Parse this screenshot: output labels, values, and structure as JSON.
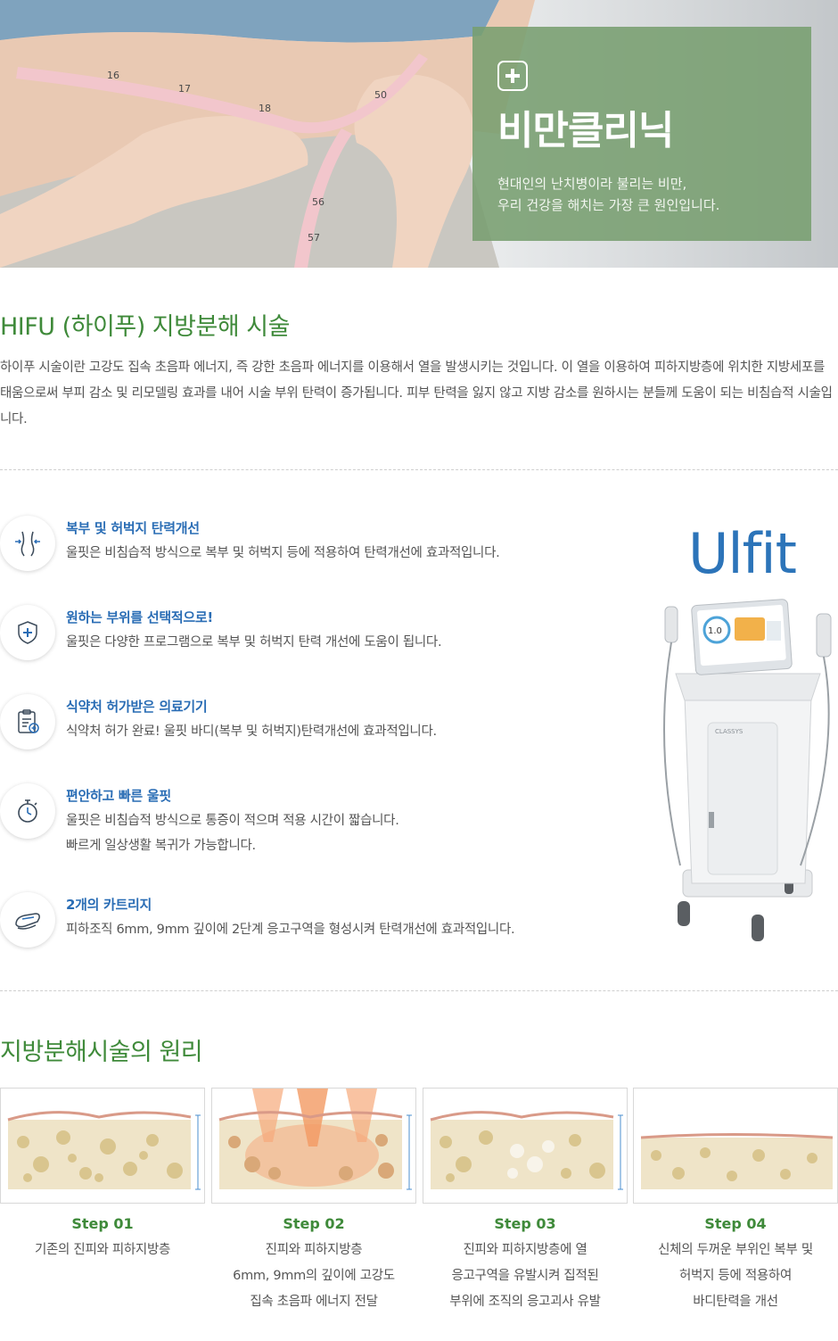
{
  "hero": {
    "title": "비만클리닉",
    "subtitle": "현대인의 난치병이라 불리는 비만,\n우리 건강을 해치는 가장 큰 원인입니다."
  },
  "intro": {
    "title": "HIFU (하이푸) 지방분해 시술",
    "text": "하이푸 시술이란 고강도 집속 초음파 에너지, 즉 강한 초음파 에너지를 이용해서 열을 발생시키는 것입니다. 이 열을 이용하여 피하지방층에 위치한 지방세포를 태움으로써 부피 감소 및 리모델링 효과를 내어 시술 부위 탄력이 증가됩니다. 피부 탄력을 잃지 않고 지방 감소를 원하시는 분들께 도움이 되는 비침습적 시술입니다."
  },
  "features": [
    {
      "icon": "body-contour-icon",
      "title": "복부 및 허벅지 탄력개선",
      "desc": "울핏은 비침습적 방식으로 복부 및 허벅지 등에 적용하여 탄력개선에 효과적입니다."
    },
    {
      "icon": "shield-plus-icon",
      "title": "원하는 부위를 선택적으로!",
      "desc": "울핏은 다양한 프로그램으로 복부 및 허벅지 탄력 개선에 도움이 됩니다."
    },
    {
      "icon": "clipboard-cert-icon",
      "title": "식약처 허가받은 의료기기",
      "desc": "식약처 허가 완료! 울핏 바디(복부 및 허벅지)탄력개선에 효과적입니다."
    },
    {
      "icon": "stopwatch-icon",
      "title": "편안하고 빠른 울핏",
      "desc": "울핏은 비침습적 방식으로 통증이 적으며 적용 시간이 짧습니다.\n빠르게 일상생활 복귀가 가능합니다."
    },
    {
      "icon": "cartridge-icon",
      "title": "2개의 카트리지",
      "desc": "피하조직 6mm, 9mm 깊이에 2단계 응고구역을 형성시켜 탄력개선에 효과적입니다."
    }
  ],
  "device": {
    "brand": "Ulfit",
    "screen_value": "1.0",
    "maker": "CLASSYS"
  },
  "principle": {
    "title": "지방분해시술의 원리",
    "steps": [
      {
        "label": "Step 01",
        "desc": "기존의 진피와 피하지방층"
      },
      {
        "label": "Step 02",
        "desc": "진피와 피하지방층\n6mm, 9mm의 깊이에 고강도\n집속 초음파 에너지 전달"
      },
      {
        "label": "Step 03",
        "desc": "진피와 피하지방층에 열\n응고구역을 유발시켜 집적된\n부위에 조직의 응고괴사 유발"
      },
      {
        "label": "Step 04",
        "desc": "신체의 두꺼운 부위인 복부 및\n허벅지 등에 적용하여\n바디탄력을 개선"
      }
    ]
  },
  "colors": {
    "accent_green": "#3f8a3a",
    "accent_blue": "#2a6db5",
    "panel_green": "#789e70"
  }
}
